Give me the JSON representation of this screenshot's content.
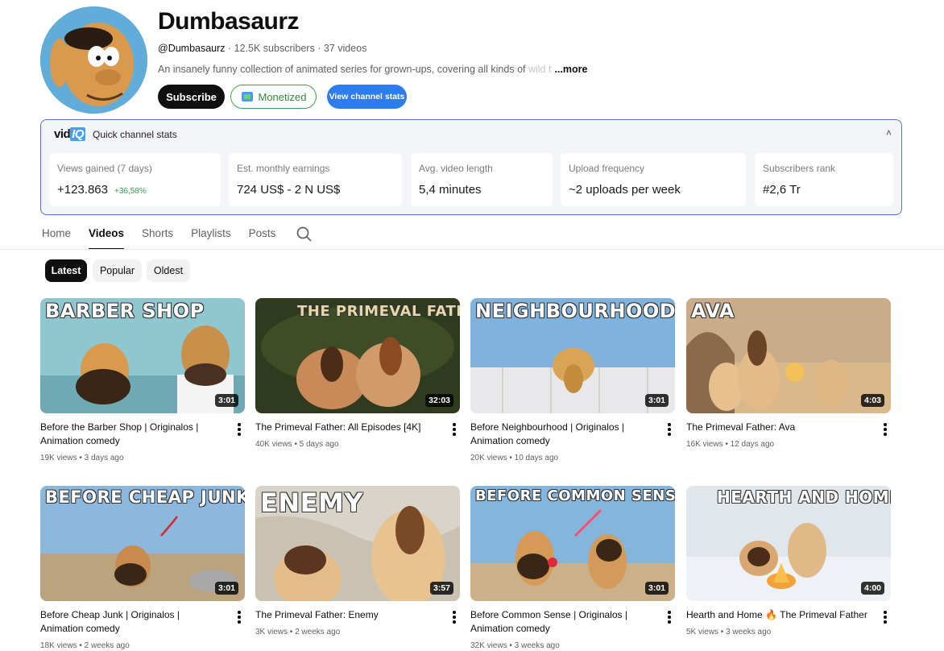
{
  "channel": {
    "name": "Dumbasaurz",
    "handle": "@Dumbasaurz",
    "stats": " · 12.5K subscribers · 37 videos",
    "description": "An insanely funny collection of animated series for grown-ups, covering all kinds of ",
    "description_fade": "wild t",
    "more_label": "...more",
    "subscribe_label": "Subscribe",
    "monetized_label": "Monetized",
    "view_stats_label": "View channel stats"
  },
  "vidiq": {
    "logo_vid": "vid",
    "logo_iq": "IQ",
    "title": "Quick channel stats",
    "caret": "˄",
    "stats": [
      {
        "label": "Views gained (7 days)",
        "value": "+123.863",
        "delta": "+36,58%"
      },
      {
        "label": "Est. monthly earnings",
        "value": "724 US$ - 2 N US$"
      },
      {
        "label": "Avg. video length",
        "value": "5,4 minutes"
      },
      {
        "label": "Upload frequency",
        "value": "~2 uploads per week"
      },
      {
        "label": "Subscribers rank",
        "value": "#2,6 Tr"
      }
    ]
  },
  "tabs": [
    "Home",
    "Videos",
    "Shorts",
    "Playlists",
    "Posts"
  ],
  "active_tab": "Videos",
  "chips": [
    "Latest",
    "Popular",
    "Oldest"
  ],
  "active_chip": "Latest",
  "videos": [
    {
      "thumb_text": "BARBER SHOP",
      "duration": "3:01",
      "title": "Before the Barber Shop | Originalos | Animation comedy",
      "meta": "19K views • 3 days ago"
    },
    {
      "thumb_text": "THE PRIMEVAL FATHER",
      "duration": "32:03",
      "title": "The Primeval Father: All Episodes [4K]",
      "meta": "40K views • 5 days ago"
    },
    {
      "thumb_text": "NEIGHBOURHOOD",
      "duration": "3:01",
      "title": "Before Neighbourhood | Originalos | Animation comedy",
      "meta": "20K views • 10 days ago"
    },
    {
      "thumb_text": "AVA",
      "duration": "4:03",
      "title": "The Primeval Father: Ava",
      "meta": "16K views • 12 days ago"
    },
    {
      "thumb_text": "BEFORE CHEAP JUNK",
      "duration": "3:01",
      "title": "Before Cheap Junk | Originalos | Animation comedy",
      "meta": "18K views • 2 weeks ago"
    },
    {
      "thumb_text": "ENEMY",
      "duration": "3:57",
      "title": "The Primeval Father: Enemy",
      "meta": "3K views • 2 weeks ago"
    },
    {
      "thumb_text": "BEFORE COMMON SENSE",
      "duration": "3:01",
      "title": "Before Common Sense | Originalos | Animation comedy",
      "meta": "32K views • 3 weeks ago"
    },
    {
      "thumb_text": "HEARTH AND HOME",
      "duration": "4:00",
      "title": "Hearth and Home 🔥 The Primeval Father",
      "meta": "5K views • 3 weeks ago"
    }
  ],
  "colors": {
    "accent_blue": "#2d7cf0",
    "monetized_green": "#3fa34d",
    "vidiq_border": "#4b78c8",
    "delta_green": "#2e9d4a"
  }
}
